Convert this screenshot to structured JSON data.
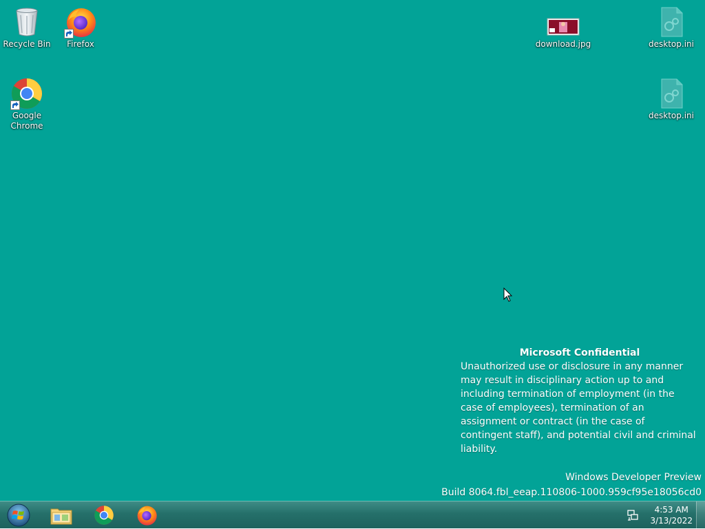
{
  "desktop": {
    "background_color": "#02a397",
    "icons": [
      {
        "label": "Recycle Bin",
        "icon": "recycle-bin-icon"
      },
      {
        "label": "Firefox",
        "icon": "firefox-icon"
      },
      {
        "label": "Google Chrome",
        "icon": "chrome-icon"
      },
      {
        "label": "download.jpg",
        "icon": "image-file-icon"
      },
      {
        "label": "desktop.ini",
        "icon": "settings-file-icon"
      },
      {
        "label": "desktop.ini",
        "icon": "settings-file-icon"
      }
    ]
  },
  "confidential": {
    "title": "Microsoft Confidential",
    "body": "Unauthorized use or disclosure in any manner may result in disciplinary action up to and including termination of employment (in the case of employees), termination of an assignment or contract (in the case of contingent staff), and potential civil and criminal liability."
  },
  "watermark": {
    "line1": "Windows Developer Preview",
    "line2": "Build 8064.fbl_eeap.110806-1000.959cf95e18056cd0"
  },
  "taskbar": {
    "start_icon": "windows-start-orb-icon",
    "pinned": [
      {
        "name": "File Explorer",
        "icon": "file-explorer-icon"
      },
      {
        "name": "Google Chrome",
        "icon": "chrome-icon"
      },
      {
        "name": "Firefox",
        "icon": "firefox-icon"
      }
    ],
    "tray": {
      "network_icon": "network-icon",
      "time": "4:53 AM",
      "date": "3/13/2022"
    }
  }
}
